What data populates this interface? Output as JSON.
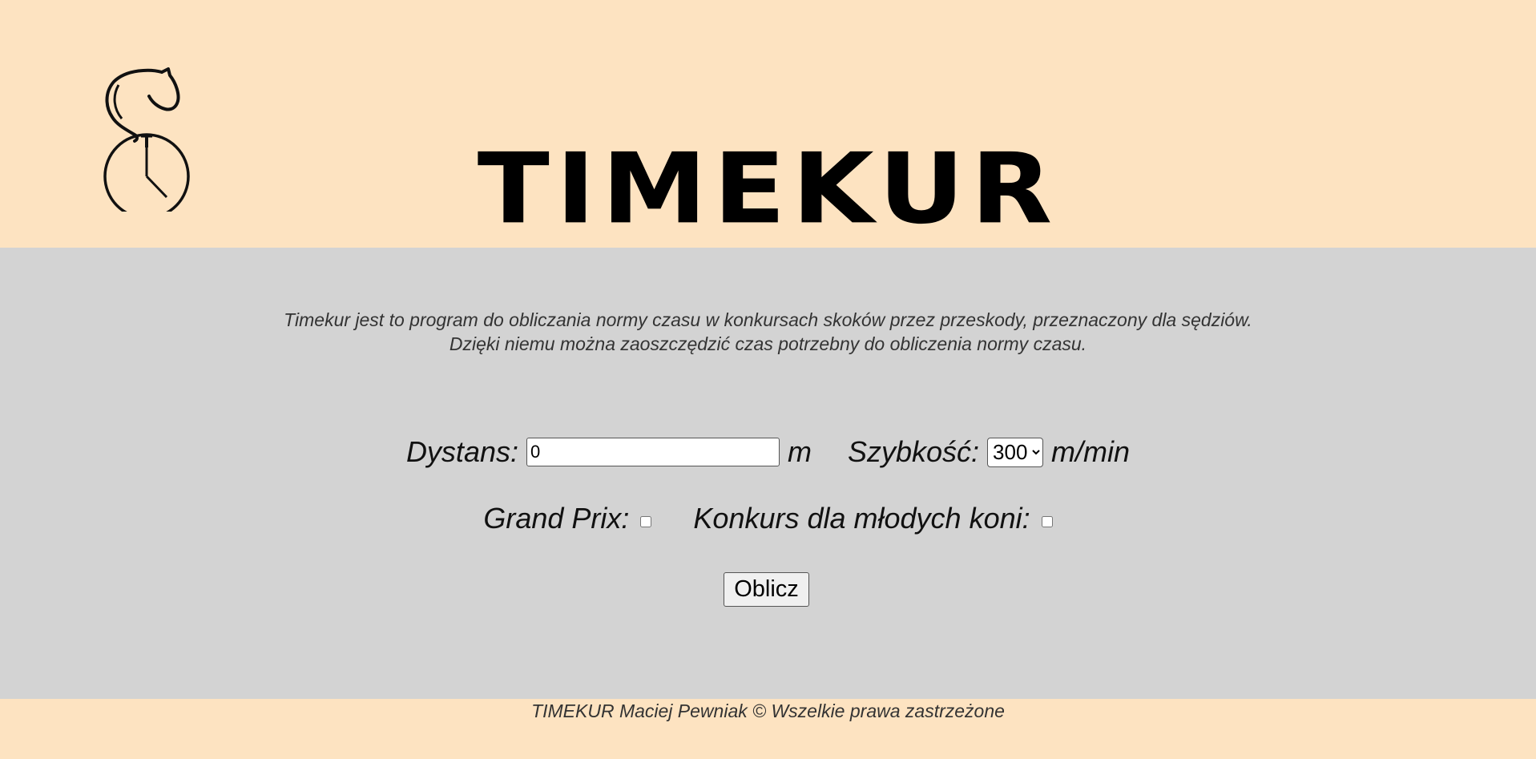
{
  "header": {
    "title": "TIMEKUR",
    "logo_icon": "horse-stopwatch-logo-icon"
  },
  "main": {
    "description_line1": "Timekur jest to program do obliczania normy czasu w konkursach skoków przez przeskody, przeznaczony dla sędziów.",
    "description_line2": "Dzięki niemu można zaoszczędzić czas potrzebny do obliczenia normy czasu.",
    "distance_label": "Dystans:",
    "distance_value": "0",
    "distance_unit": "m",
    "speed_label": "Szybkość:",
    "speed_selected": "300",
    "speed_unit": "m/min",
    "grand_prix_label": "Grand Prix:",
    "grand_prix_checked": false,
    "young_horses_label": "Konkurs dla młodych koni:",
    "young_horses_checked": false,
    "calculate_label": "Oblicz"
  },
  "footer": {
    "text": "TIMEKUR Maciej Pewniak © Wszelkie prawa zastrzeżone"
  },
  "colors": {
    "header_bg": "#fde3c1",
    "main_bg": "#d3d3d3",
    "footer_bg": "#fde3c1"
  }
}
